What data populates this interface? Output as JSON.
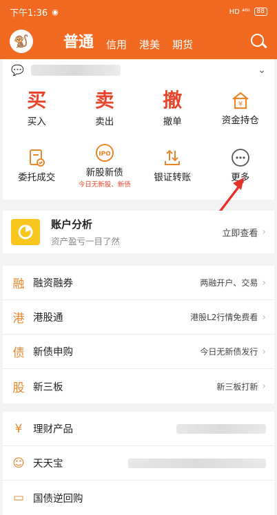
{
  "status_bar": {
    "time": "下午1:36",
    "signal": "HD ⁴⁶ᴵˡ",
    "battery": "88"
  },
  "header": {
    "avatar_glyph": "🐒",
    "tabs": [
      {
        "label": "普通",
        "active": true
      },
      {
        "label": "信用"
      },
      {
        "label": "港美"
      },
      {
        "label": "期货"
      }
    ]
  },
  "notice": {
    "bubble_glyph": "💬",
    "chevron": "⌄"
  },
  "grid": {
    "row1": [
      {
        "char": "买",
        "label": "买入"
      },
      {
        "char": "卖",
        "label": "卖出"
      },
      {
        "char": "撤",
        "label": "撤单"
      },
      {
        "label": "资金持仓"
      }
    ],
    "row2": [
      {
        "label": "委托成交"
      },
      {
        "label": "新股新债",
        "sub": "今日无新股、新债"
      },
      {
        "label": "银证转账"
      },
      {
        "label": "更多"
      }
    ]
  },
  "analysis": {
    "title": "账户分析",
    "subtitle": "资产盈亏一目了然",
    "link": "立即查看"
  },
  "list1": [
    {
      "icon": "融",
      "label": "融资融券",
      "right": "两融开户、交易"
    },
    {
      "icon": "港",
      "label": "港股通",
      "right": "港股L2行情免费看"
    },
    {
      "icon": "债",
      "label": "新债申购",
      "right": "今日无新债发行"
    },
    {
      "icon": "股",
      "label": "新三板",
      "right": "新三板打新"
    }
  ],
  "list2": [
    {
      "icon": "¥",
      "label": "理财产品"
    },
    {
      "icon": "☺",
      "label": "天天宝"
    },
    {
      "icon": "▭",
      "label": "国债逆回购"
    }
  ],
  "colors": {
    "brand": "#f26a21",
    "accent_red": "#e8452c",
    "icon_orange": "#e8862c",
    "arrow": "#e8312a"
  }
}
